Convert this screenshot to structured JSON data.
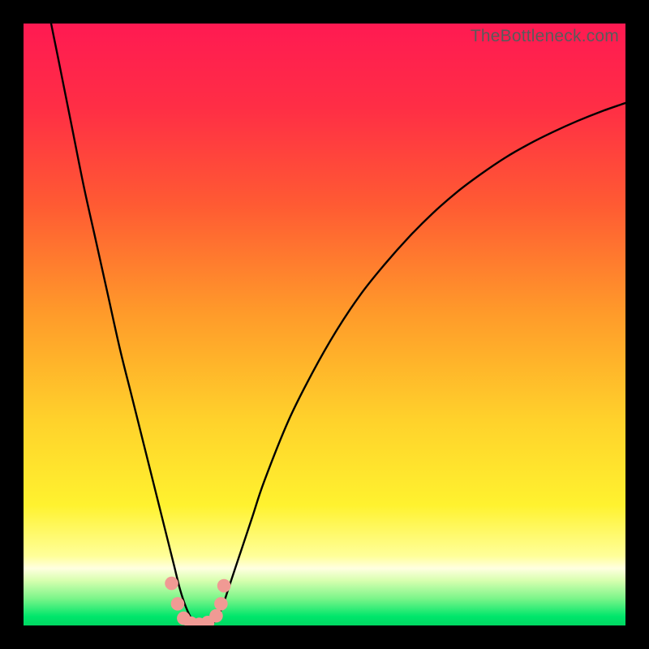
{
  "watermark": "TheBottleneck.com",
  "colors": {
    "frame_bg": "#000000",
    "curve_stroke": "#000000",
    "marker_fill": "#f09a94",
    "grad_top": "#ff1a52",
    "grad_mid_red": "#ff3b3b",
    "grad_orange": "#ff8a2a",
    "grad_yellow": "#ffe12e",
    "grad_paleyellow": "#ffff9a",
    "grad_green": "#00e66b"
  },
  "chart_data": {
    "type": "line",
    "title": "",
    "xlabel": "",
    "ylabel": "",
    "xlim": [
      0,
      100
    ],
    "ylim": [
      0,
      100
    ],
    "x": [
      0,
      2,
      4,
      6,
      8,
      10,
      12,
      14,
      16,
      18,
      20,
      22,
      24,
      25,
      26,
      27,
      28,
      29,
      30,
      31,
      32,
      33,
      34,
      36,
      38,
      40,
      44,
      48,
      52,
      56,
      60,
      64,
      68,
      72,
      76,
      80,
      84,
      88,
      92,
      96,
      100
    ],
    "values": [
      125,
      114,
      103,
      93,
      83,
      73,
      64,
      55,
      46,
      38,
      30,
      22,
      14,
      10,
      6,
      3,
      1,
      0,
      0,
      0,
      1,
      3,
      6,
      12,
      18,
      24,
      34,
      42,
      49,
      55,
      60,
      64.5,
      68.5,
      72,
      75,
      77.7,
      80,
      82,
      83.8,
      85.4,
      86.8
    ],
    "markers": {
      "x": [
        24.6,
        25.6,
        26.6,
        27.8,
        29.2,
        30.6,
        32.0,
        32.8,
        33.3
      ],
      "y": [
        7.0,
        3.6,
        1.2,
        0.4,
        0.2,
        0.5,
        1.6,
        3.6,
        6.6
      ]
    },
    "gradient_stops": [
      {
        "offset": 0.0,
        "color": "#ff1a52"
      },
      {
        "offset": 0.14,
        "color": "#ff2e45"
      },
      {
        "offset": 0.3,
        "color": "#ff5a33"
      },
      {
        "offset": 0.48,
        "color": "#ff9a2a"
      },
      {
        "offset": 0.66,
        "color": "#ffd22b"
      },
      {
        "offset": 0.8,
        "color": "#fff22f"
      },
      {
        "offset": 0.885,
        "color": "#ffff9a"
      },
      {
        "offset": 0.905,
        "color": "#ffffe0"
      },
      {
        "offset": 0.925,
        "color": "#d8ffb0"
      },
      {
        "offset": 0.955,
        "color": "#7cf58a"
      },
      {
        "offset": 0.985,
        "color": "#00e66b"
      },
      {
        "offset": 1.0,
        "color": "#00d862"
      }
    ]
  }
}
